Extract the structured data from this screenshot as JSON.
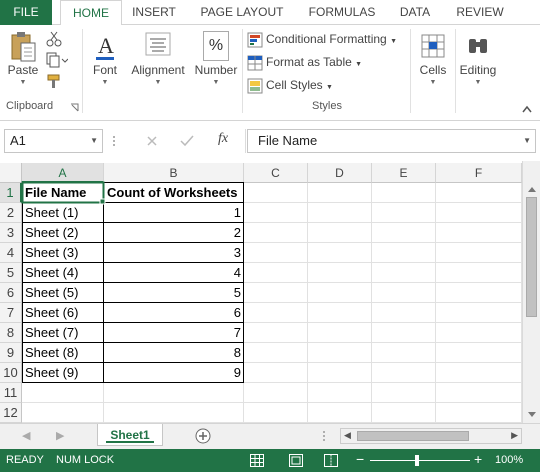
{
  "ribbon_tabs": [
    "FILE",
    "HOME",
    "INSERT",
    "PAGE LAYOUT",
    "FORMULAS",
    "DATA",
    "REVIEW"
  ],
  "ribbon": {
    "paste_label": "Paste",
    "clipboard_label": "Clipboard",
    "font_label": "Font",
    "alignment_label": "Alignment",
    "number_label": "Number",
    "number_icon": "%",
    "conditional_formatting": "Conditional Formatting",
    "format_as_table": "Format as Table",
    "cell_styles": "Cell Styles",
    "styles_label": "Styles",
    "cells_label": "Cells",
    "editing_label": "Editing"
  },
  "formula_bar": {
    "name_box": "A1",
    "formula": "File Name"
  },
  "columns": [
    "A",
    "B",
    "C",
    "D",
    "E",
    "F"
  ],
  "rows": [
    "1",
    "2",
    "3",
    "4",
    "5",
    "6",
    "7",
    "8",
    "9",
    "10",
    "11",
    "12"
  ],
  "table": {
    "headers": [
      "File Name",
      "Count of Worksheets"
    ],
    "data": [
      [
        "Sheet (1)",
        "1"
      ],
      [
        "Sheet (2)",
        "2"
      ],
      [
        "Sheet (3)",
        "3"
      ],
      [
        "Sheet (4)",
        "4"
      ],
      [
        "Sheet (5)",
        "5"
      ],
      [
        "Sheet (6)",
        "6"
      ],
      [
        "Sheet (7)",
        "7"
      ],
      [
        "Sheet (8)",
        "8"
      ],
      [
        "Sheet (9)",
        "9"
      ]
    ]
  },
  "sheet_tab": "Sheet1",
  "status": {
    "ready": "READY",
    "num_lock": "NUM LOCK",
    "zoom": "100%"
  },
  "colors": {
    "accent": "#217346",
    "status_bg": "#217346"
  }
}
